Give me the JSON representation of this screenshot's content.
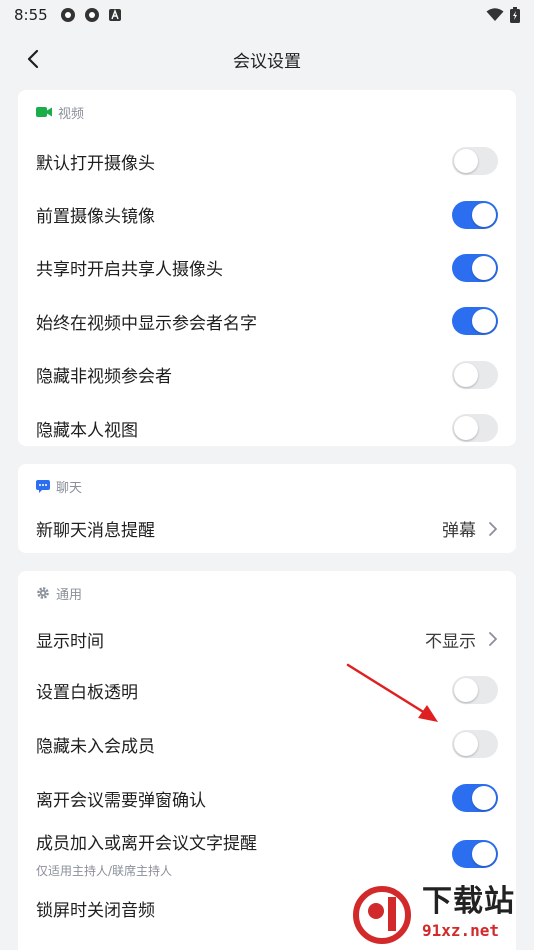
{
  "status_bar": {
    "time": "8:55"
  },
  "header": {
    "title": "会议设置"
  },
  "sections": {
    "video": {
      "title": "视频",
      "items": [
        {
          "label": "默认打开摄像头",
          "enabled": false
        },
        {
          "label": "前置摄像头镜像",
          "enabled": true
        },
        {
          "label": "共享时开启共享人摄像头",
          "enabled": true
        },
        {
          "label": "始终在视频中显示参会者名字",
          "enabled": true
        },
        {
          "label": "隐藏非视频参会者",
          "enabled": false
        },
        {
          "label": "隐藏本人视图",
          "enabled": false
        }
      ]
    },
    "chat": {
      "title": "聊天",
      "item": {
        "label": "新聊天消息提醒",
        "value": "弹幕"
      }
    },
    "general": {
      "title": "通用",
      "display_time": {
        "label": "显示时间",
        "value": "不显示"
      },
      "whiteboard": {
        "label": "设置白板透明",
        "enabled": false
      },
      "hide_unjoined": {
        "label": "隐藏未入会成员",
        "enabled": false
      },
      "leave_confirm": {
        "label": "离开会议需要弹窗确认",
        "enabled": true
      },
      "join_reminder": {
        "label": "成员加入或离开会议文字提醒",
        "sub": "仅适用主持人/联席主持人",
        "enabled": true
      },
      "lock_audio": {
        "label": "锁屏时关闭音频"
      }
    }
  },
  "colors": {
    "accent": "#2b6ff0",
    "toggle_off": "#e8e9eb",
    "video_icon": "#1aad4a",
    "chat_icon": "#2b6ff0",
    "annotation_arrow": "#e02020"
  },
  "watermark": {
    "cn": "下载站",
    "url": "91xz.net"
  }
}
